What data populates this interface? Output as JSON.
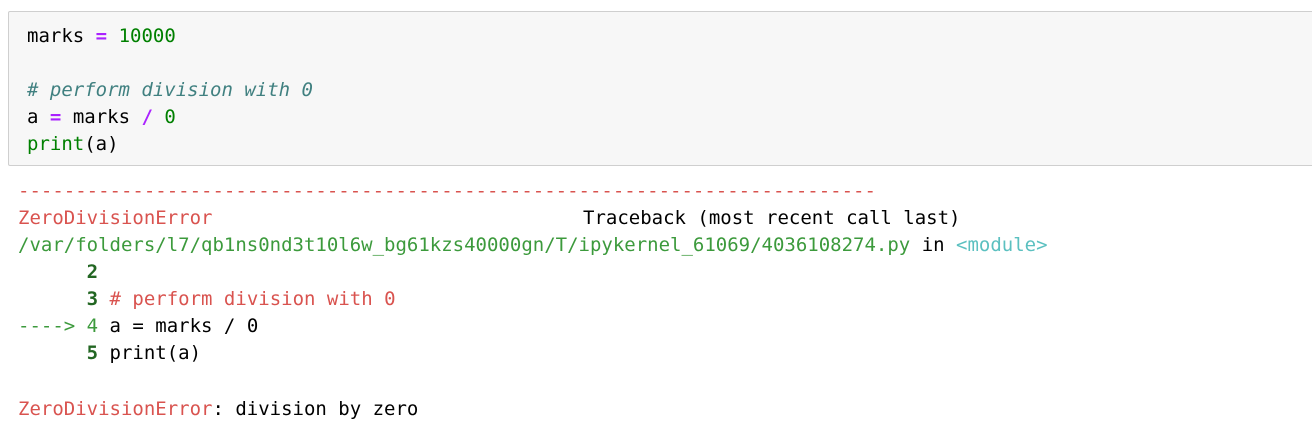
{
  "input_cell": {
    "line1": {
      "name": "marks",
      "op": "=",
      "value": "10000"
    },
    "line2": "",
    "line3": "# perform division with 0",
    "line4": {
      "name": "a",
      "op": "=",
      "expr_name": "marks",
      "div": "/",
      "value": "0"
    },
    "line5": {
      "func": "print",
      "args": "(a)"
    }
  },
  "output": {
    "dashes": "---------------------------------------------------------------------------",
    "error_name": "ZeroDivisionError",
    "traceback_header": "Traceback (most recent call last)",
    "path": "/var/folders/l7/qb1ns0nd3t10l6w_bg61kzs40000gn/T/ipykernel_61069/4036108274.py",
    "in_text": "in",
    "module": "<module>",
    "tb_lines": [
      {
        "prefix": "      ",
        "num": "2",
        "text": ""
      },
      {
        "prefix": "      ",
        "num": "3",
        "text": "# perform division with 0"
      },
      {
        "prefix": "----> ",
        "num": "4",
        "text": "a = marks / 0"
      },
      {
        "prefix": "      ",
        "num": "5",
        "text": "print(a)"
      }
    ],
    "final_error_name": "ZeroDivisionError",
    "final_error_message": ": division by zero"
  }
}
